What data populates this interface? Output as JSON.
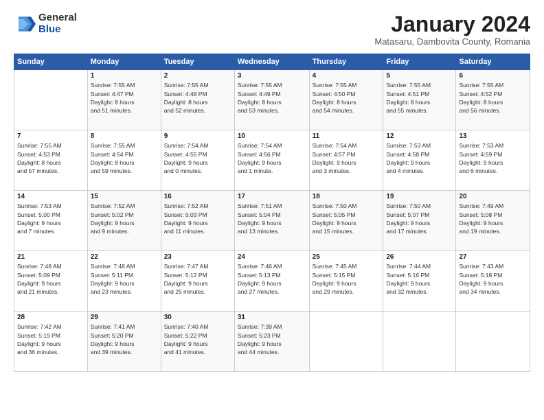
{
  "logo": {
    "general": "General",
    "blue": "Blue"
  },
  "header": {
    "title": "January 2024",
    "location": "Matasaru, Dambovita County, Romania"
  },
  "weekdays": [
    "Sunday",
    "Monday",
    "Tuesday",
    "Wednesday",
    "Thursday",
    "Friday",
    "Saturday"
  ],
  "weeks": [
    [
      {
        "num": "",
        "info": ""
      },
      {
        "num": "1",
        "info": "Sunrise: 7:55 AM\nSunset: 4:47 PM\nDaylight: 8 hours\nand 51 minutes."
      },
      {
        "num": "2",
        "info": "Sunrise: 7:55 AM\nSunset: 4:48 PM\nDaylight: 8 hours\nand 52 minutes."
      },
      {
        "num": "3",
        "info": "Sunrise: 7:55 AM\nSunset: 4:49 PM\nDaylight: 8 hours\nand 53 minutes."
      },
      {
        "num": "4",
        "info": "Sunrise: 7:55 AM\nSunset: 4:50 PM\nDaylight: 8 hours\nand 54 minutes."
      },
      {
        "num": "5",
        "info": "Sunrise: 7:55 AM\nSunset: 4:51 PM\nDaylight: 8 hours\nand 55 minutes."
      },
      {
        "num": "6",
        "info": "Sunrise: 7:55 AM\nSunset: 4:52 PM\nDaylight: 8 hours\nand 56 minutes."
      }
    ],
    [
      {
        "num": "7",
        "info": "Sunrise: 7:55 AM\nSunset: 4:53 PM\nDaylight: 8 hours\nand 57 minutes."
      },
      {
        "num": "8",
        "info": "Sunrise: 7:55 AM\nSunset: 4:54 PM\nDaylight: 8 hours\nand 59 minutes."
      },
      {
        "num": "9",
        "info": "Sunrise: 7:54 AM\nSunset: 4:55 PM\nDaylight: 9 hours\nand 0 minutes."
      },
      {
        "num": "10",
        "info": "Sunrise: 7:54 AM\nSunset: 4:56 PM\nDaylight: 9 hours\nand 1 minute."
      },
      {
        "num": "11",
        "info": "Sunrise: 7:54 AM\nSunset: 4:57 PM\nDaylight: 9 hours\nand 3 minutes."
      },
      {
        "num": "12",
        "info": "Sunrise: 7:53 AM\nSunset: 4:58 PM\nDaylight: 9 hours\nand 4 minutes."
      },
      {
        "num": "13",
        "info": "Sunrise: 7:53 AM\nSunset: 4:59 PM\nDaylight: 9 hours\nand 6 minutes."
      }
    ],
    [
      {
        "num": "14",
        "info": "Sunrise: 7:53 AM\nSunset: 5:00 PM\nDaylight: 9 hours\nand 7 minutes."
      },
      {
        "num": "15",
        "info": "Sunrise: 7:52 AM\nSunset: 5:02 PM\nDaylight: 9 hours\nand 9 minutes."
      },
      {
        "num": "16",
        "info": "Sunrise: 7:52 AM\nSunset: 5:03 PM\nDaylight: 9 hours\nand 11 minutes."
      },
      {
        "num": "17",
        "info": "Sunrise: 7:51 AM\nSunset: 5:04 PM\nDaylight: 9 hours\nand 13 minutes."
      },
      {
        "num": "18",
        "info": "Sunrise: 7:50 AM\nSunset: 5:05 PM\nDaylight: 9 hours\nand 15 minutes."
      },
      {
        "num": "19",
        "info": "Sunrise: 7:50 AM\nSunset: 5:07 PM\nDaylight: 9 hours\nand 17 minutes."
      },
      {
        "num": "20",
        "info": "Sunrise: 7:49 AM\nSunset: 5:08 PM\nDaylight: 9 hours\nand 19 minutes."
      }
    ],
    [
      {
        "num": "21",
        "info": "Sunrise: 7:48 AM\nSunset: 5:09 PM\nDaylight: 9 hours\nand 21 minutes."
      },
      {
        "num": "22",
        "info": "Sunrise: 7:48 AM\nSunset: 5:11 PM\nDaylight: 9 hours\nand 23 minutes."
      },
      {
        "num": "23",
        "info": "Sunrise: 7:47 AM\nSunset: 5:12 PM\nDaylight: 9 hours\nand 25 minutes."
      },
      {
        "num": "24",
        "info": "Sunrise: 7:46 AM\nSunset: 5:13 PM\nDaylight: 9 hours\nand 27 minutes."
      },
      {
        "num": "25",
        "info": "Sunrise: 7:45 AM\nSunset: 5:15 PM\nDaylight: 9 hours\nand 29 minutes."
      },
      {
        "num": "26",
        "info": "Sunrise: 7:44 AM\nSunset: 5:16 PM\nDaylight: 9 hours\nand 32 minutes."
      },
      {
        "num": "27",
        "info": "Sunrise: 7:43 AM\nSunset: 5:18 PM\nDaylight: 9 hours\nand 34 minutes."
      }
    ],
    [
      {
        "num": "28",
        "info": "Sunrise: 7:42 AM\nSunset: 5:19 PM\nDaylight: 9 hours\nand 36 minutes."
      },
      {
        "num": "29",
        "info": "Sunrise: 7:41 AM\nSunset: 5:20 PM\nDaylight: 9 hours\nand 39 minutes."
      },
      {
        "num": "30",
        "info": "Sunrise: 7:40 AM\nSunset: 5:22 PM\nDaylight: 9 hours\nand 41 minutes."
      },
      {
        "num": "31",
        "info": "Sunrise: 7:39 AM\nSunset: 5:23 PM\nDaylight: 9 hours\nand 44 minutes."
      },
      {
        "num": "",
        "info": ""
      },
      {
        "num": "",
        "info": ""
      },
      {
        "num": "",
        "info": ""
      }
    ]
  ]
}
